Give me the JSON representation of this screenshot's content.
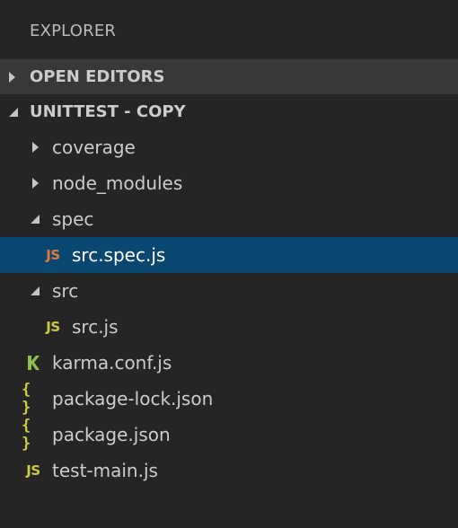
{
  "explorer": {
    "title": "EXPLORER"
  },
  "sections": {
    "open_editors": {
      "label": "OPEN EDITORS",
      "expanded": false
    },
    "workspace": {
      "label": "UNITTEST - COPY",
      "expanded": true
    }
  },
  "tree": {
    "coverage": "coverage",
    "node_modules": "node_modules",
    "spec": "spec",
    "src_spec_js": "src.spec.js",
    "src": "src",
    "src_js": "src.js",
    "karma_conf": "karma.conf.js",
    "package_lock": "package-lock.json",
    "package_json": "package.json",
    "test_main": "test-main.js"
  },
  "icons": {
    "js_glyph": "JS",
    "json_glyph": "{ }",
    "karma_glyph": "K"
  },
  "colors": {
    "background": "#252526",
    "selection": "#094771",
    "js_yellow": "#cbcb41",
    "js_test_orange": "#e37933",
    "karma_green": "#8dc149"
  },
  "selected_item": "src.spec.js"
}
